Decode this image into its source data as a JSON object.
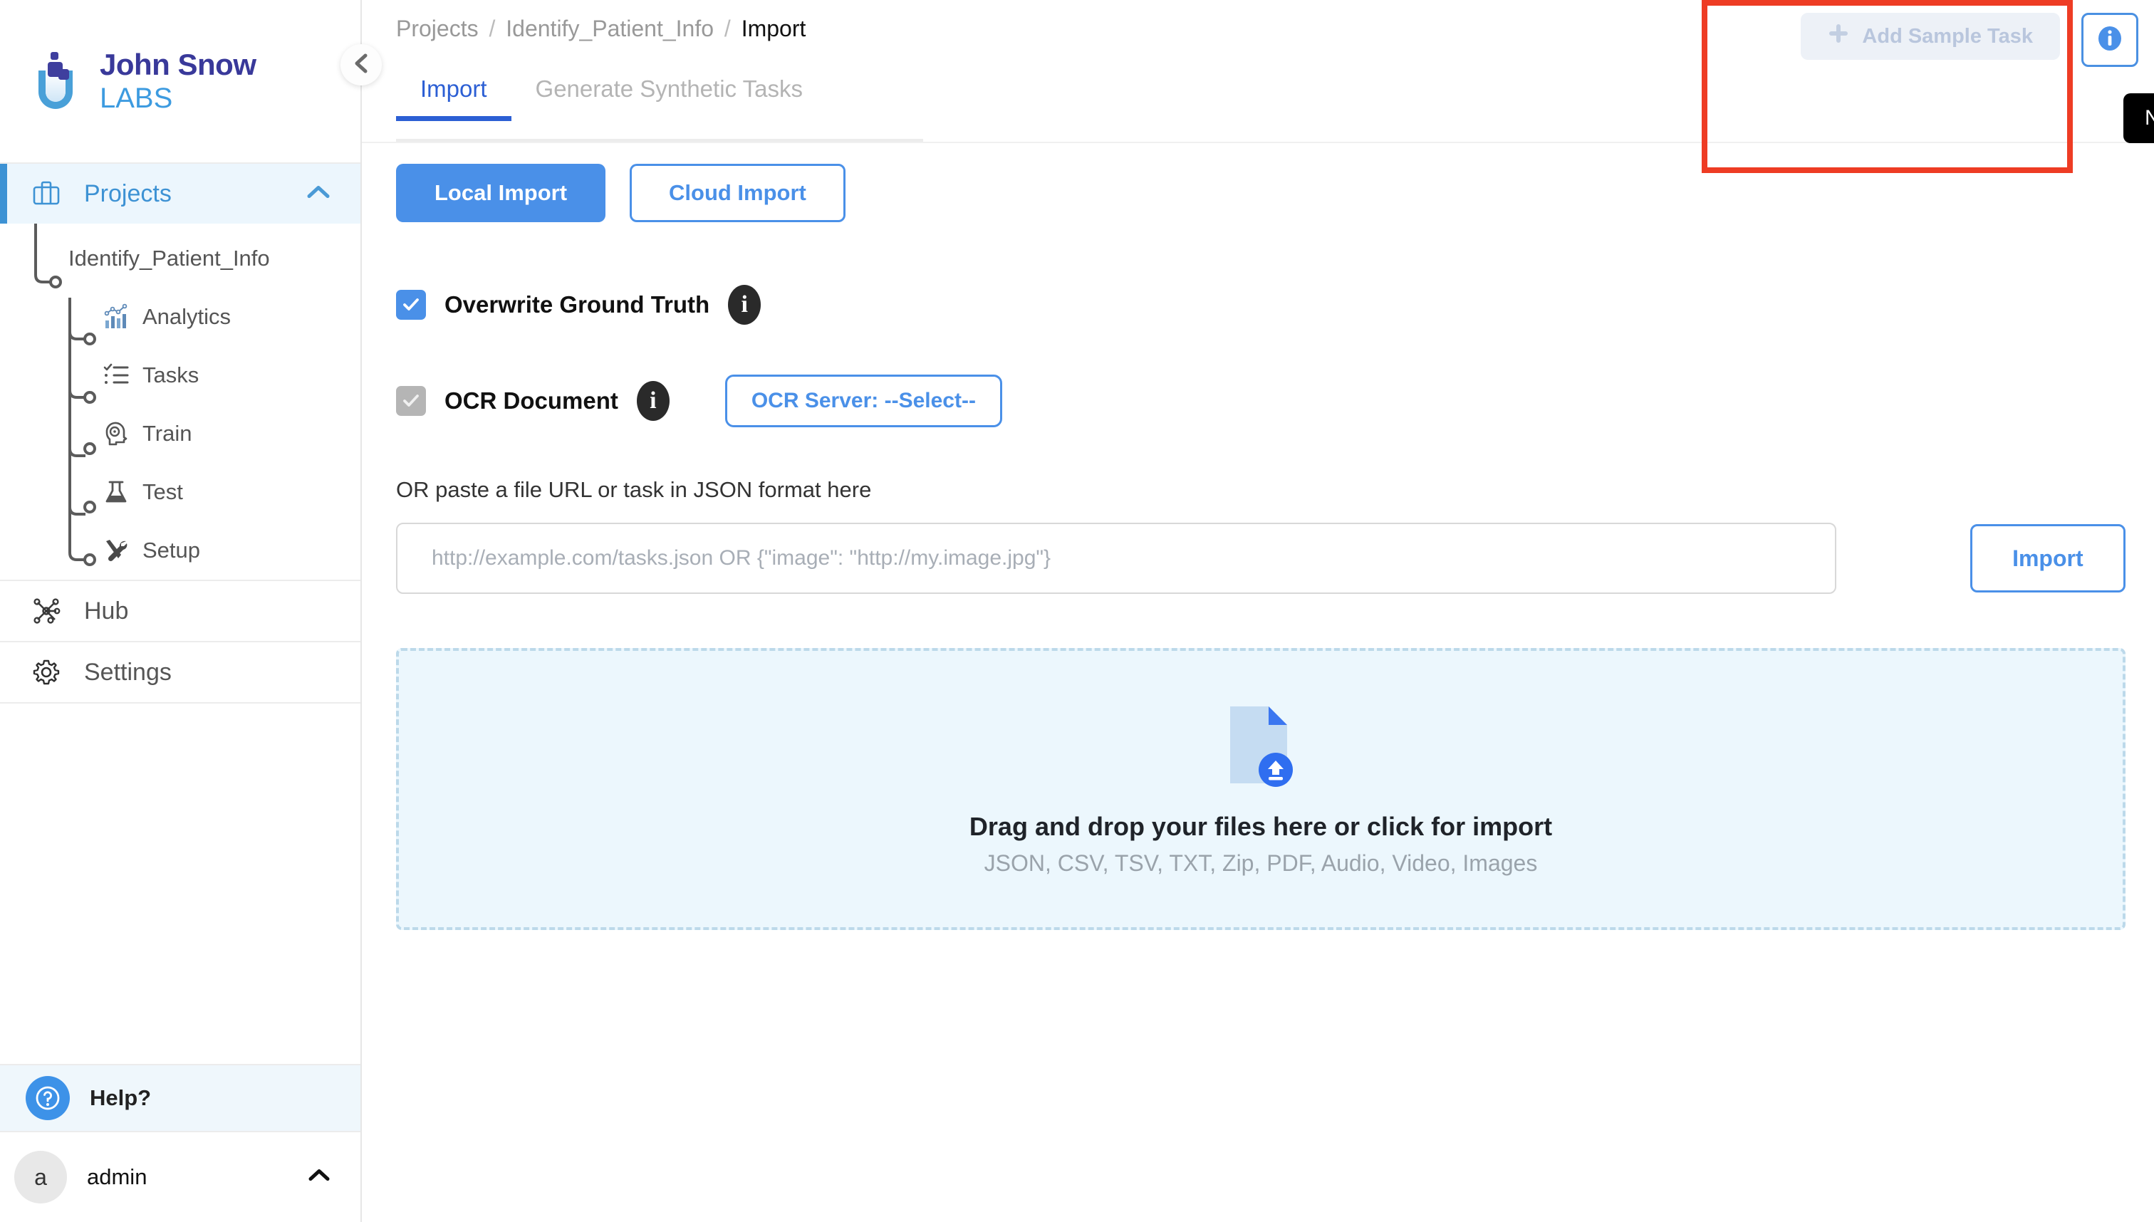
{
  "brand": {
    "line1": "John Snow",
    "line2": "LABS",
    "logo_icon": "beaker-logo-icon"
  },
  "sidebar": {
    "collapse_icon": "chevron-left-icon",
    "projects": {
      "label": "Projects",
      "icon": "briefcase-icon",
      "chevron": "chevron-up-icon"
    },
    "project_name": "Identify_Patient_Info",
    "project_children": [
      {
        "label": "Analytics",
        "icon": "analytics-chart-icon"
      },
      {
        "label": "Tasks",
        "icon": "checklist-icon"
      },
      {
        "label": "Train",
        "icon": "brain-head-icon"
      },
      {
        "label": "Test",
        "icon": "flask-icon"
      },
      {
        "label": "Setup",
        "icon": "tools-icon"
      }
    ],
    "bottom_items": [
      {
        "label": "Hub",
        "icon": "network-nodes-icon"
      },
      {
        "label": "Settings",
        "icon": "gear-icon"
      }
    ],
    "help": {
      "label": "Help?",
      "icon": "question-mark-icon"
    },
    "user": {
      "avatar_initial": "a",
      "name": "admin",
      "chevron": "chevron-up-icon"
    }
  },
  "header": {
    "breadcrumb": {
      "root": "Projects",
      "project": "Identify_Patient_Info",
      "current": "Import",
      "separator": "/"
    },
    "tabs": [
      {
        "label": "Import",
        "active": true
      },
      {
        "label": "Generate Synthetic Tasks",
        "active": false
      }
    ],
    "add_sample_task": {
      "label": "Add Sample Task",
      "icon": "plus-icon",
      "disabled": true
    },
    "info_button_icon": "info-circle-icon",
    "tooltip": "No OCR servers Available!",
    "annotation_color": "#ee3c24"
  },
  "main": {
    "import_mode_buttons": [
      {
        "label": "Local Import",
        "style": "primary"
      },
      {
        "label": "Cloud Import",
        "style": "outline"
      }
    ],
    "options": [
      {
        "label": "Overwrite Ground Truth",
        "checked": true,
        "state": "enabled",
        "info_icon": "info-badge-icon"
      },
      {
        "label": "OCR Document",
        "checked": true,
        "state": "disabled",
        "info_icon": "info-badge-icon"
      }
    ],
    "ocr_server_button": "OCR Server: --Select--",
    "paste_label": "OR paste a file URL or task in JSON format here",
    "url_input": {
      "value": "",
      "placeholder": "http://example.com/tasks.json OR {\"image\": \"http://my.image.jpg\"}"
    },
    "import_button": "Import",
    "dropzone": {
      "icon": "file-upload-icon",
      "title": "Drag and drop your files here or click for import",
      "subtitle": "JSON, CSV, TSV, TXT, Zip, PDF, Audio, Video, Images"
    }
  },
  "colors": {
    "accent_blue": "#4a90e8",
    "tab_blue": "#2c5fd4",
    "brand_navy": "#39399a",
    "brand_lightblue": "#3d9be0",
    "annotation_red": "#ee3c24",
    "dropzone_bg": "#ecf7fd"
  }
}
